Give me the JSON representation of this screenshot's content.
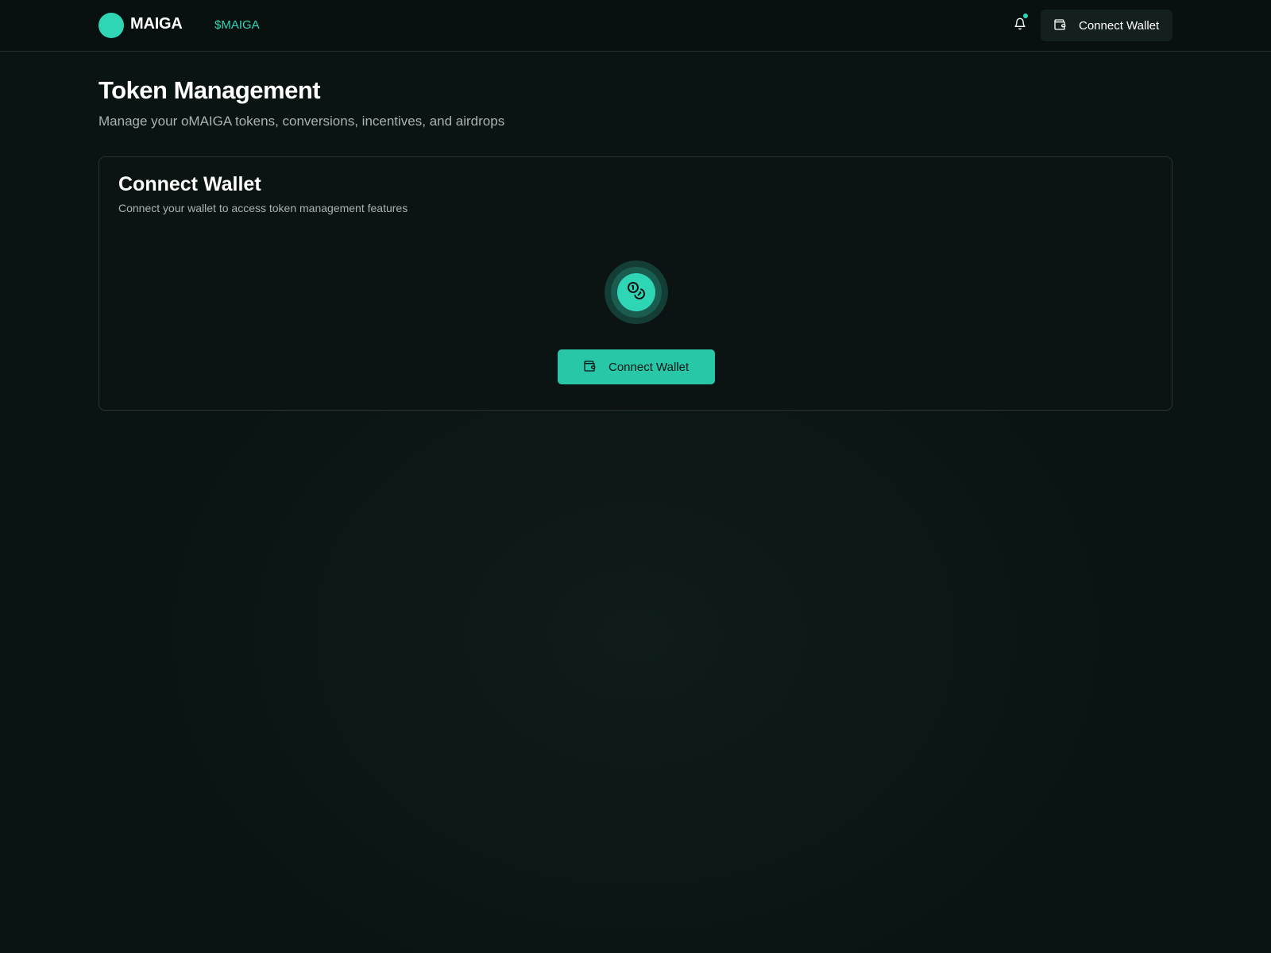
{
  "header": {
    "brand": "MAIGA",
    "token_link": "$MAIGA",
    "connect_label": "Connect Wallet",
    "icons": {
      "logo": "logo-circle",
      "notification": "bell-icon",
      "wallet": "wallet-icon"
    }
  },
  "page": {
    "title": "Token Management",
    "subtitle": "Manage your oMAIGA tokens, conversions, incentives, and airdrops"
  },
  "card": {
    "title": "Connect Wallet",
    "description": "Connect your wallet to access token management features",
    "button_label": "Connect Wallet",
    "icon": "coins-icon"
  },
  "colors": {
    "accent": "#2fd6b5",
    "background": "#0a1413",
    "button_bg": "#27c7a8"
  }
}
